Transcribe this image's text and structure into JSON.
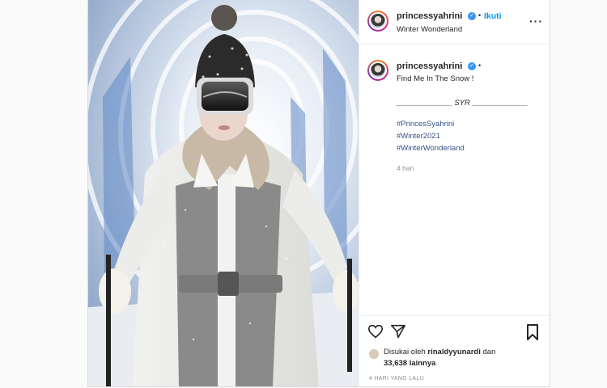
{
  "post": {
    "username": "princessyahrini",
    "follow_label": "Ikuti",
    "location": "Winter Wonderland",
    "more_icon": "more-horizontal-icon",
    "verified_icon": "verified-badge-icon"
  },
  "caption": {
    "username": "princessyahrini",
    "text": "Find Me In The Snow !",
    "signature": "_____________ SYR _____________",
    "hashtags": [
      "#PrincesSyahrini",
      "#Winter2021",
      "#WinterWonderland"
    ],
    "time": "4 hari"
  },
  "actions": {
    "like_icon": "heart-icon",
    "share_icon": "send-icon",
    "save_icon": "bookmark-icon"
  },
  "likes": {
    "prefix": "Disukai oleh",
    "user": "rinaldyyunardi",
    "connector": "dan",
    "count": "33,638 lainnya"
  },
  "timestamp": "4 HARI YANG LALU",
  "colors": {
    "link_blue": "#0095f6",
    "hashtag_blue": "#385185",
    "text": "#262626",
    "muted": "#8e8e8e",
    "border": "#dbdbdb"
  }
}
